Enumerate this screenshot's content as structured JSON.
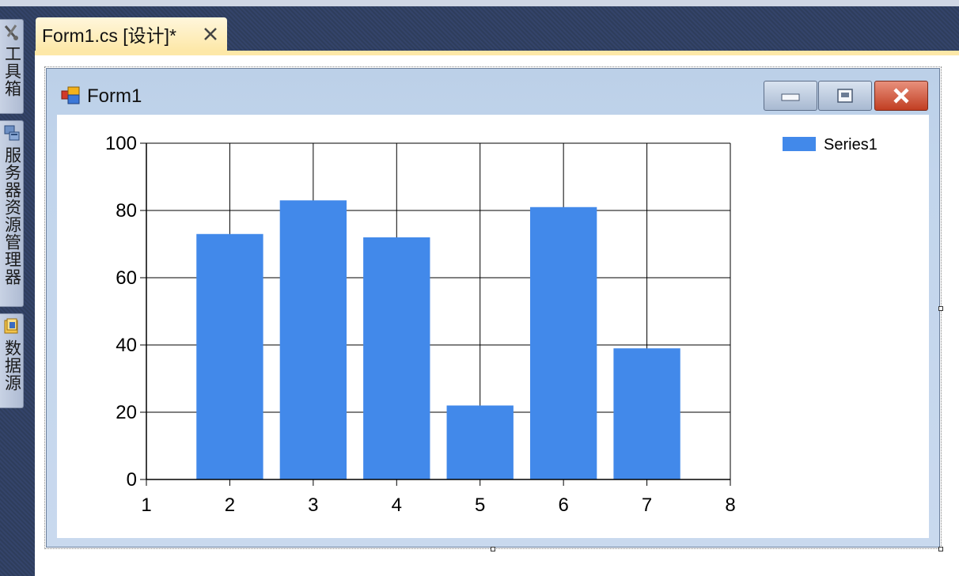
{
  "dock": {
    "toolbox_label": "工具箱",
    "server_explorer_label": "服务器资源管理器",
    "data_sources_label": "数据源",
    "toolbox_icon": "tools-icon",
    "server_explorer_icon": "server-icon",
    "data_sources_icon": "database-icon"
  },
  "tab": {
    "title": "Form1.cs [设计]*",
    "close_icon": "close-icon"
  },
  "form": {
    "title": "Form1",
    "icon": "form-icon",
    "minimize_icon": "minimize-icon",
    "maximize_icon": "maximize-icon",
    "close_icon": "close-icon"
  },
  "colors": {
    "bar": "#4289ea",
    "close_button": "#c13e22",
    "tab_active": "#fde8a8"
  },
  "chart_data": {
    "type": "bar",
    "x": [
      2,
      3,
      4,
      5,
      6,
      7
    ],
    "series": [
      {
        "name": "Series1",
        "values": [
          73,
          83,
          72,
          22,
          81,
          39
        ]
      }
    ],
    "xlim": [
      1,
      8
    ],
    "ylim": [
      0,
      100
    ],
    "x_ticks": [
      1,
      2,
      3,
      4,
      5,
      6,
      7,
      8
    ],
    "y_ticks": [
      0,
      20,
      40,
      60,
      80,
      100
    ],
    "grid": true,
    "legend": "top-right"
  }
}
